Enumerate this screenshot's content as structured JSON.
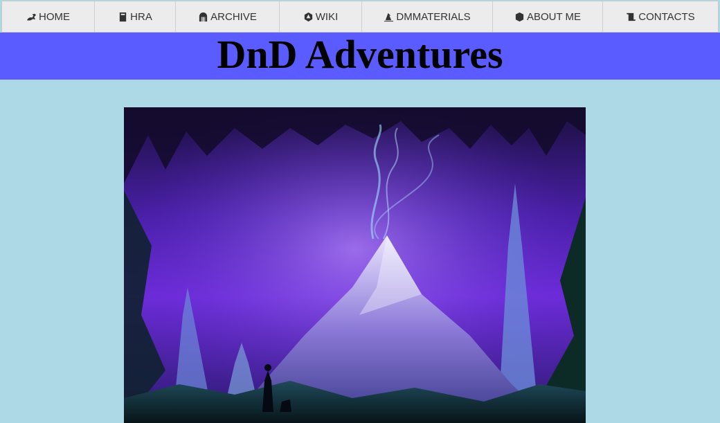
{
  "nav": {
    "items": [
      {
        "label": "HOME",
        "icon": "dragon-icon"
      },
      {
        "label": "HRA",
        "icon": "book-icon"
      },
      {
        "label": "ARCHIVE",
        "icon": "dungeon-icon"
      },
      {
        "label": "WIKI",
        "icon": "d20-icon"
      },
      {
        "label": "DMMATERIALS",
        "icon": "wizard-hat-icon"
      },
      {
        "label": "ABOUT ME",
        "icon": "dice-d6-icon"
      },
      {
        "label": "CONTACTS",
        "icon": "scroll-icon"
      }
    ]
  },
  "banner": {
    "title": "DnD Adventures"
  },
  "colors": {
    "page_bg": "#add8e6",
    "nav_bg": "#ececec",
    "banner_bg": "#5a5cff"
  }
}
